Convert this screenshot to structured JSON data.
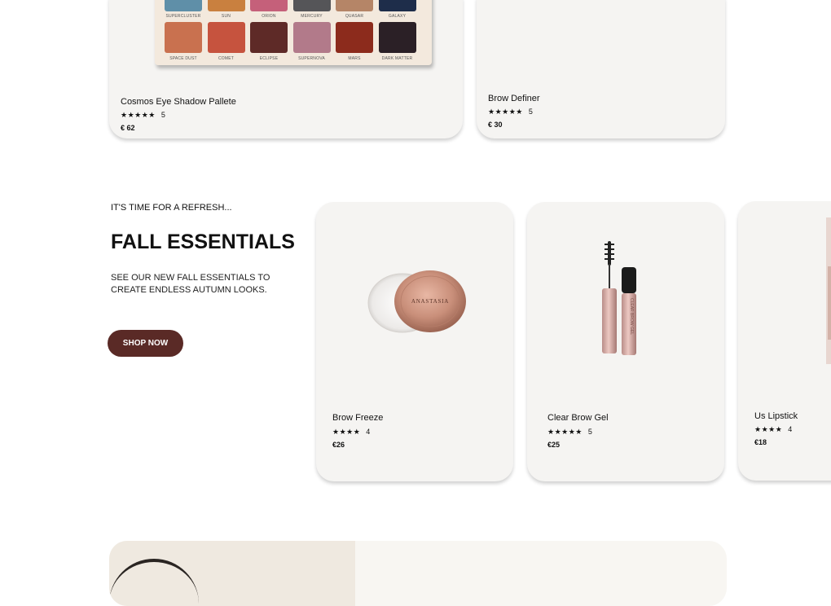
{
  "products_top": [
    {
      "name": "Cosmos Eye Shadow Pallete",
      "stars": "★★★★★",
      "rating": "5",
      "price": "€ 62"
    },
    {
      "name": "Brow Definer",
      "stars": "★★★★★",
      "rating": "5",
      "price": "€ 30"
    }
  ],
  "palette": {
    "swatch_names_row1": [
      "SUPERCLUSTER",
      "SUN",
      "ORION",
      "MERCURY",
      "QUASAR",
      "GALAXY"
    ],
    "swatch_names_row2": [
      "SPACE DUST",
      "COMET",
      "ECLIPSE",
      "SUPERNOVA",
      "MARS",
      "DARK MATTER"
    ],
    "swatch_colors_row1": [
      "#5f8fa8",
      "#c9803f",
      "#c5607a",
      "#555558",
      "#b58567",
      "#1e2d4a"
    ],
    "swatch_colors_row2": [
      "#c9714f",
      "#c6533e",
      "#5e2a27",
      "#b27a8a",
      "#8c2b1c",
      "#2b2026"
    ]
  },
  "promo": {
    "kicker": "IT'S TIME FOR A REFRESH...",
    "headline": "FALL ESSENTIALS",
    "subtext": "SEE OUR NEW FALL ESSENTIALS TO  CREATE ENDLESS AUTUMN LOOKS.",
    "button_label": "SHOP NOW",
    "button_color": "#5a2a26"
  },
  "products_fall": [
    {
      "name": "Brow Freeze",
      "stars": "★★★★",
      "rating": "4",
      "price": "€26",
      "jar_label": "ANASTASIA"
    },
    {
      "name": "Clear Brow Gel",
      "stars": "★★★★★",
      "rating": "5",
      "price": "€25",
      "tube_label": "CLEAR BROW GEL"
    },
    {
      "name": "Us Lipstick",
      "stars": "★★★★",
      "rating": "4",
      "price": "€18"
    }
  ]
}
